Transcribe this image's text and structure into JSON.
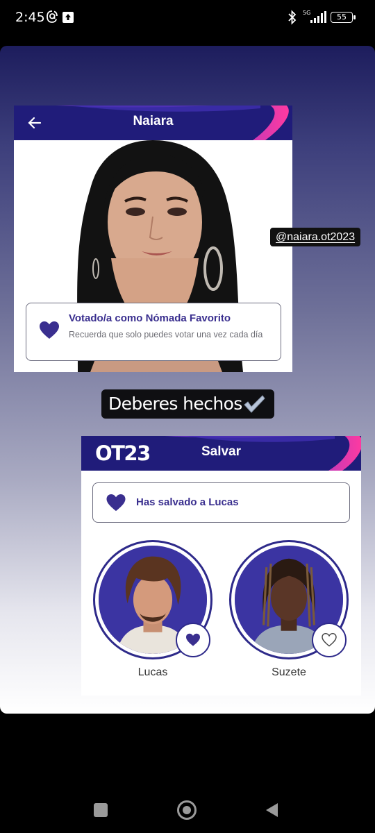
{
  "status_bar": {
    "time": "2:45",
    "network": "5G",
    "battery": "55"
  },
  "story": {
    "shot1": {
      "header_title": "Naiara",
      "vote_title": "Votado/a como Nómada Favorito",
      "vote_subtitle": "Recuerda que solo puedes votar una vez cada día"
    },
    "mention_tag": "@naiara.ot2023",
    "caption": "Deberes hechos",
    "shot2": {
      "logo": "OT23",
      "header_title": "Salvar",
      "saved_message": "Has salvado a Lucas",
      "candidates": [
        {
          "name": "Lucas",
          "selected": true
        },
        {
          "name": "Suzete",
          "selected": false
        }
      ]
    }
  },
  "colors": {
    "brand_purple": "#3a2f8f",
    "header_navy": "#201c7a",
    "accent_pink": "#e0349e"
  }
}
